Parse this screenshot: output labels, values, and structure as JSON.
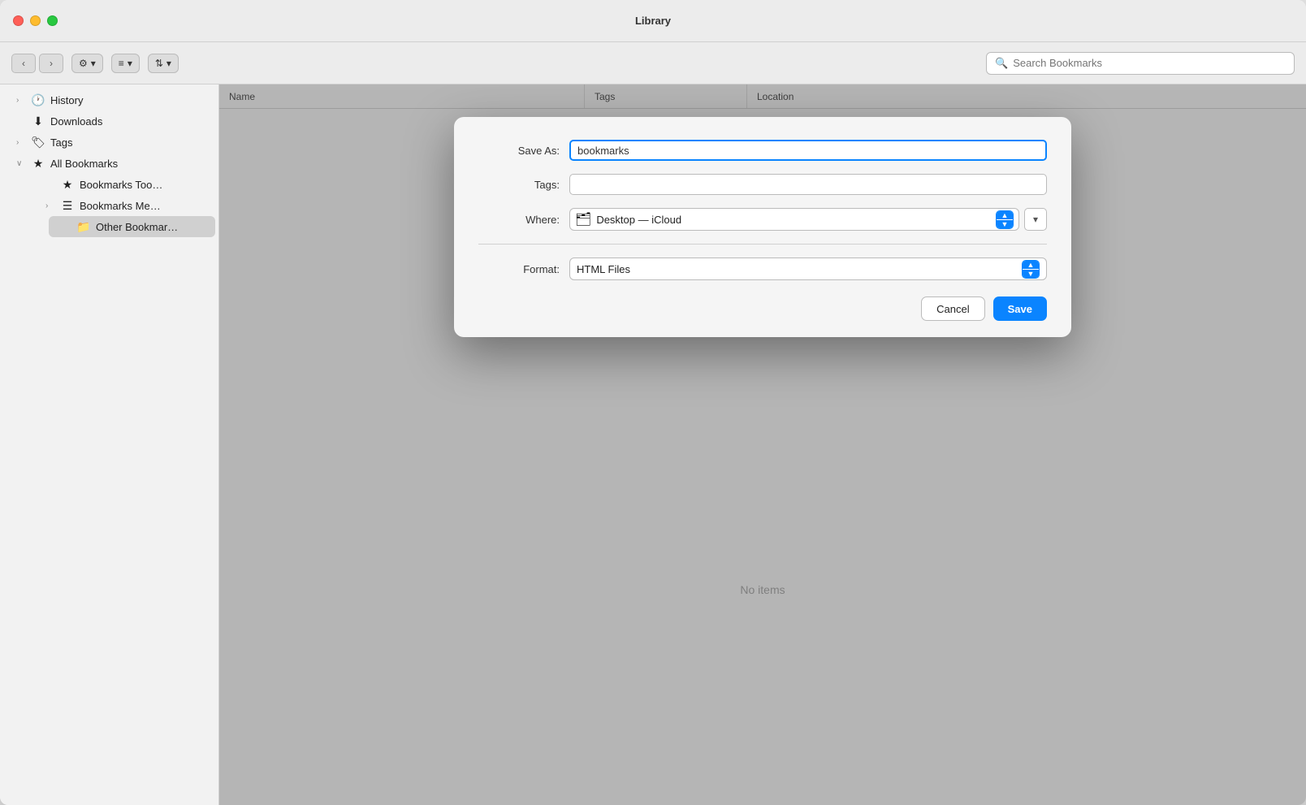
{
  "window": {
    "title": "Library"
  },
  "toolbar": {
    "back_label": "‹",
    "forward_label": "›",
    "organize_label": "⚙",
    "organize_dropdown": "▾",
    "view_label": "≡",
    "view_dropdown": "▾",
    "sort_label": "⇅",
    "sort_dropdown": "▾",
    "search_placeholder": "Search Bookmarks"
  },
  "sidebar": {
    "items": [
      {
        "id": "history",
        "label": "History",
        "icon": "🕐",
        "chevron": "›",
        "indent": 0
      },
      {
        "id": "downloads",
        "label": "Downloads",
        "icon": "⬇",
        "indent": 0
      },
      {
        "id": "tags",
        "label": "Tags",
        "icon": "🏷",
        "chevron": "›",
        "indent": 0
      },
      {
        "id": "all-bookmarks",
        "label": "All Bookmarks",
        "icon": "★",
        "chevron": "∨",
        "indent": 0
      },
      {
        "id": "bookmarks-toolbar",
        "label": "Bookmarks Too…",
        "icon": "★",
        "indent": 1
      },
      {
        "id": "bookmarks-menu",
        "label": "Bookmarks Me…",
        "icon": "☰",
        "chevron": "›",
        "indent": 1
      },
      {
        "id": "other-bookmarks",
        "label": "Other Bookmar…",
        "icon": "📁",
        "indent": 2
      }
    ]
  },
  "table": {
    "columns": [
      "Name",
      "Tags",
      "Location"
    ],
    "no_items_label": "No items"
  },
  "dialog": {
    "save_as_label": "Save As:",
    "save_as_value": "bookmarks",
    "tags_label": "Tags:",
    "tags_placeholder": "",
    "where_label": "Where:",
    "where_value": "Desktop — iCloud",
    "format_label": "Format:",
    "format_value": "HTML Files",
    "cancel_label": "Cancel",
    "save_label": "Save",
    "folder_icon": "🗂",
    "expand_icon": "▾"
  }
}
